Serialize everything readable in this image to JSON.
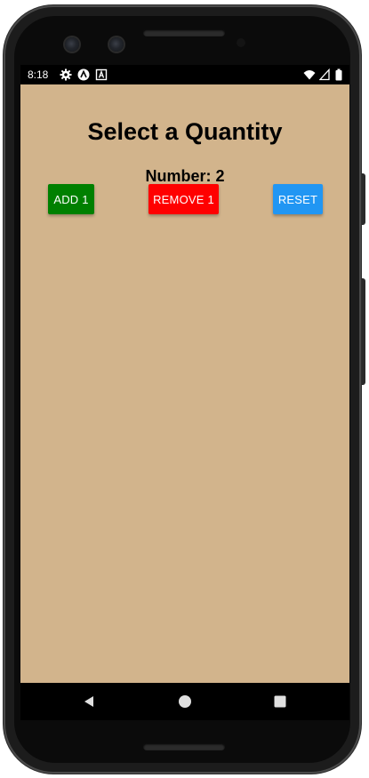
{
  "status_bar": {
    "time": "8:18",
    "left_icons": [
      "settings-gear-icon",
      "react-native-icon",
      "font-a-icon"
    ],
    "right_icons": [
      "wifi-icon",
      "cellular-signal-icon",
      "battery-icon"
    ]
  },
  "app": {
    "background_color": "#d2b48c",
    "title": "Select a Quantity",
    "number_label": "Number: 2",
    "buttons": {
      "add": {
        "label": "ADD 1",
        "color": "#008000"
      },
      "remove": {
        "label": "REMOVE 1",
        "color": "#ff0000"
      },
      "reset": {
        "label": "RESET",
        "color": "#2196f3"
      }
    }
  },
  "nav_bar": {
    "buttons": [
      "back-triangle-icon",
      "home-circle-icon",
      "recents-square-icon"
    ]
  }
}
